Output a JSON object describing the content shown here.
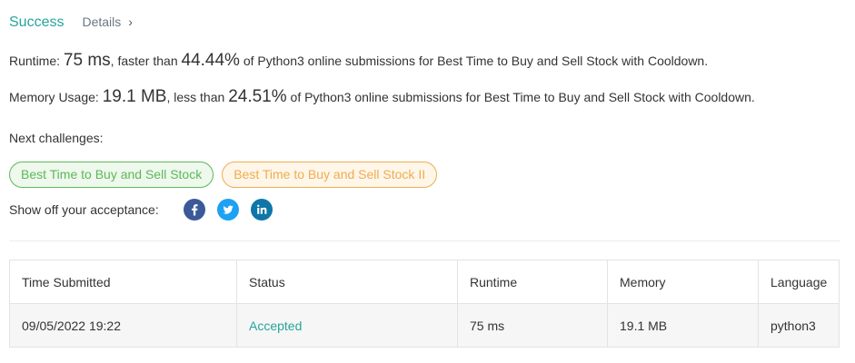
{
  "header": {
    "status": "Success",
    "details_label": "Details",
    "details_chevron": "›"
  },
  "runtime": {
    "label": "Runtime:",
    "value": "75 ms",
    "comparison": ", faster than",
    "percent": "44.44%",
    "suffix": "of Python3 online submissions for Best Time to Buy and Sell Stock with Cooldown."
  },
  "memory": {
    "label": "Memory Usage:",
    "value": "19.1 MB",
    "comparison": ", less than",
    "percent": "24.51%",
    "suffix": "of Python3 online submissions for Best Time to Buy and Sell Stock with Cooldown."
  },
  "next_challenges": {
    "label": "Next challenges:",
    "items": [
      {
        "label": "Best Time to Buy and Sell Stock",
        "color": "#5cb85c"
      },
      {
        "label": "Best Time to Buy and Sell Stock II",
        "color": "#f0ad4e"
      }
    ]
  },
  "share": {
    "label": "Show off your acceptance:",
    "icons": [
      "facebook-icon",
      "twitter-icon",
      "linkedin-icon"
    ]
  },
  "table": {
    "headers": [
      "Time Submitted",
      "Status",
      "Runtime",
      "Memory",
      "Language"
    ],
    "rows": [
      [
        "09/05/2022 19:22",
        "Accepted",
        "75 ms",
        "19.1 MB",
        "python3"
      ]
    ]
  },
  "colors": {
    "accent": "#26a69a",
    "green_chip": "#5cb85c",
    "orange_chip": "#f0ad4e",
    "facebook": "#3b5998",
    "twitter": "#1da1f2",
    "linkedin": "#0e76a8"
  }
}
